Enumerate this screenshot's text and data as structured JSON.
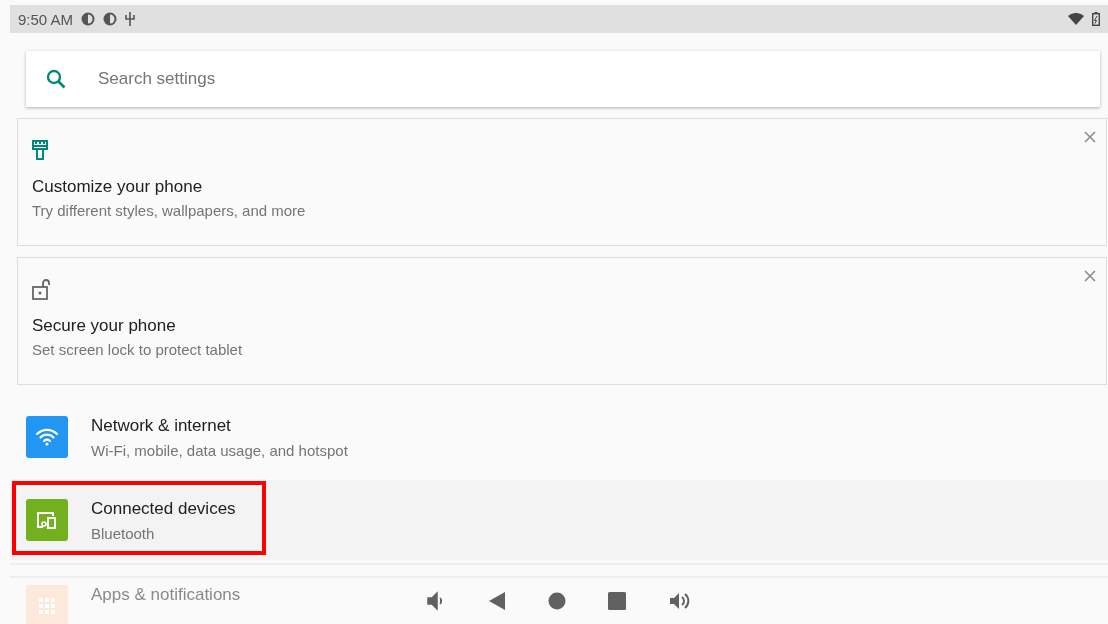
{
  "status_bar": {
    "time": "9:50 AM"
  },
  "search": {
    "placeholder": "Search settings"
  },
  "suggestions": [
    {
      "kind": "brush",
      "title": "Customize your phone",
      "summary": "Try different styles, wallpapers, and more"
    },
    {
      "kind": "lock",
      "title": "Secure your phone",
      "summary": "Set screen lock to protect tablet"
    }
  ],
  "settings": [
    {
      "kind": "wifi",
      "color": "#2196f3",
      "title": "Network & internet",
      "summary": "Wi-Fi, mobile, data usage, and hotspot",
      "highlighted": false,
      "faded": false
    },
    {
      "kind": "devices",
      "color": "#72b01d",
      "title": "Connected devices",
      "summary": "Bluetooth",
      "highlighted": true,
      "faded": false
    },
    {
      "kind": "apps",
      "color": "#fde8dc",
      "title": "Apps & notifications",
      "highlighted": false,
      "faded": true
    }
  ]
}
